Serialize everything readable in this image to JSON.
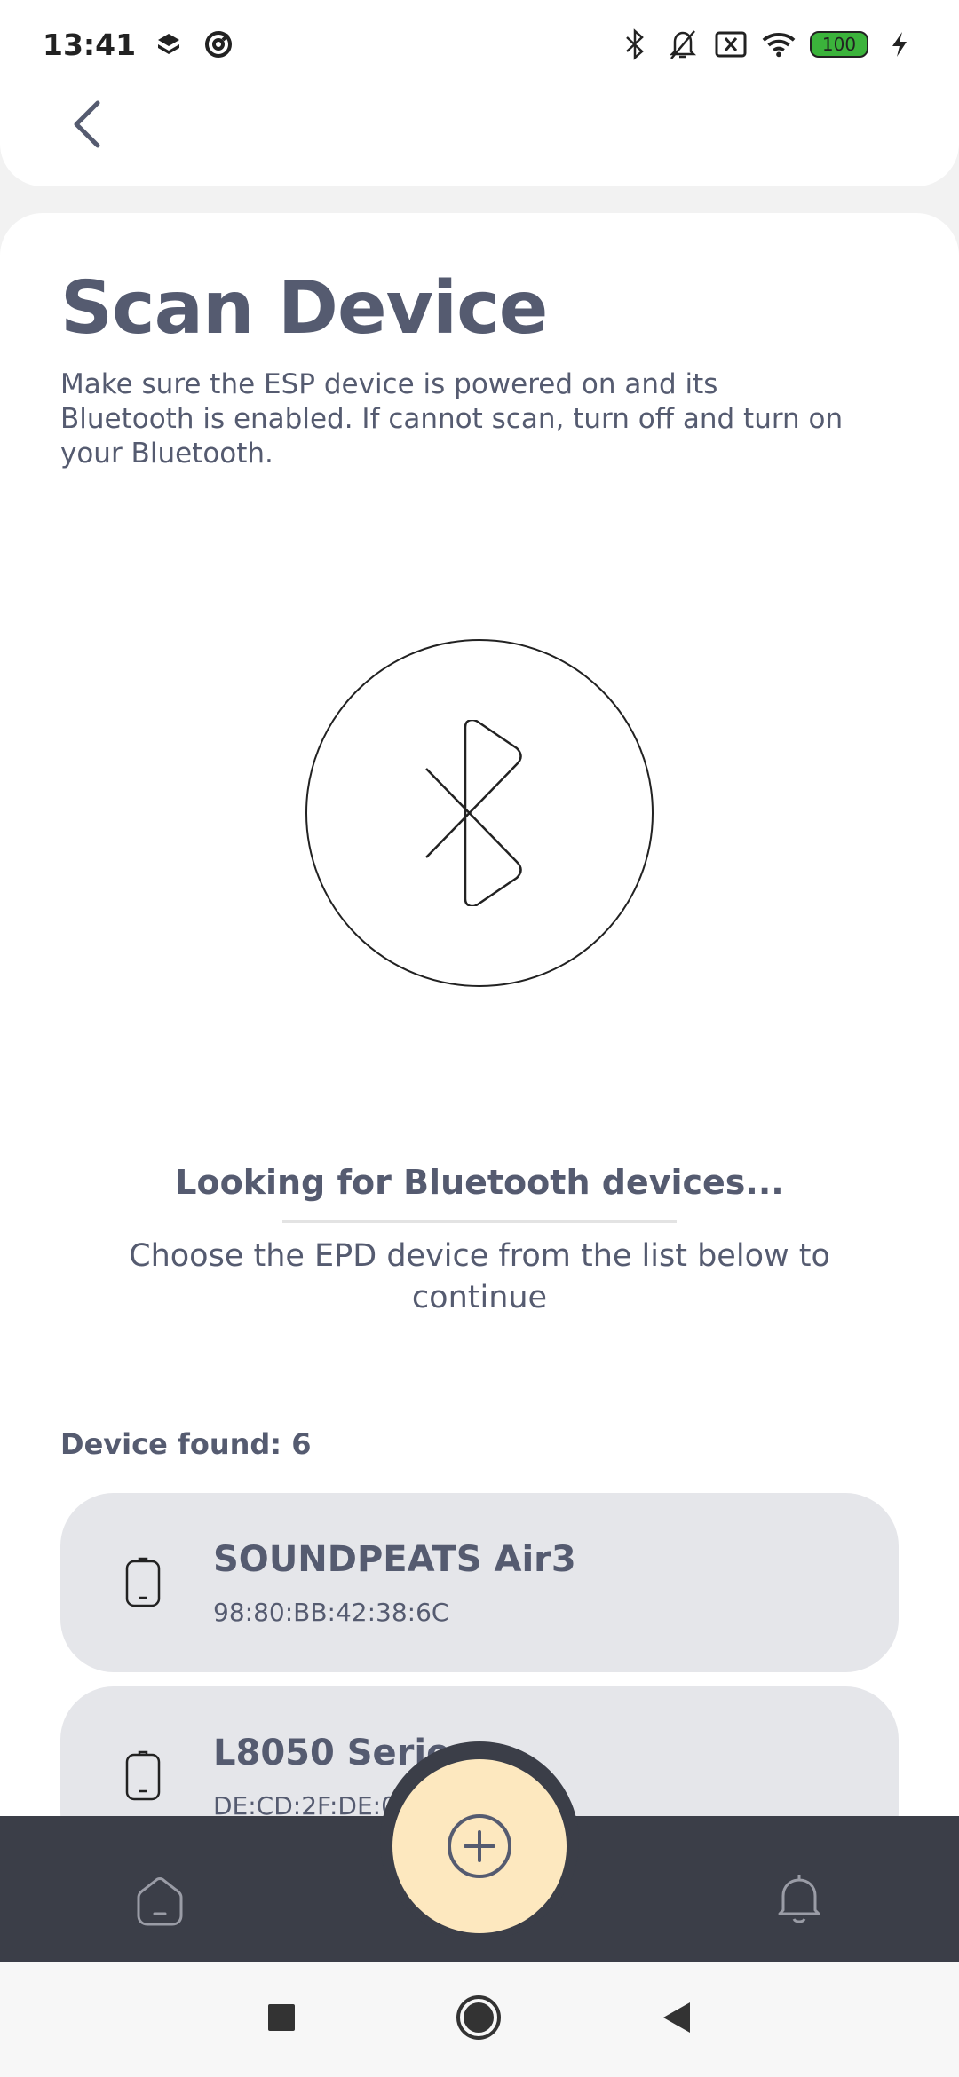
{
  "status_bar": {
    "time": "13:41",
    "battery_level": "100",
    "icons": [
      "layers-icon",
      "at-sign-icon",
      "bluetooth-icon",
      "bell-off-icon",
      "sim-card-x-icon",
      "wifi-icon",
      "battery-icon",
      "charging-bolt-icon"
    ]
  },
  "header": {
    "back_icon": "chevron-left-icon"
  },
  "main": {
    "title": "Scan Device",
    "description": "Make sure the ESP device is powered on and its Bluetooth is enabled. If cannot scan, turn off and turn on your Bluetooth.",
    "scan_icon": "bluetooth-icon",
    "looking_text": "Looking for Bluetooth devices...",
    "choose_text": "Choose the EPD device from the list below to continue",
    "found_label": "Device found: 6"
  },
  "devices": [
    {
      "name": "SOUNDPEATS Air3",
      "mac": "98:80:BB:42:38:6C",
      "icon": "device-icon"
    },
    {
      "name": "L8050 Series",
      "mac": "DE:CD:2F:DE:0",
      "icon": "device-icon"
    }
  ],
  "bottom_nav": {
    "items": [
      "home-icon",
      "add-icon",
      "bell-icon"
    ]
  },
  "system_nav": {
    "items": [
      "recents-icon",
      "home-circle-icon",
      "back-triangle-icon"
    ]
  },
  "colors": {
    "text": "#555b70",
    "card": "#e5e6ea",
    "nav_bg": "#3b3e48",
    "fab": "#fde8bf",
    "battery": "#3bb33b"
  }
}
